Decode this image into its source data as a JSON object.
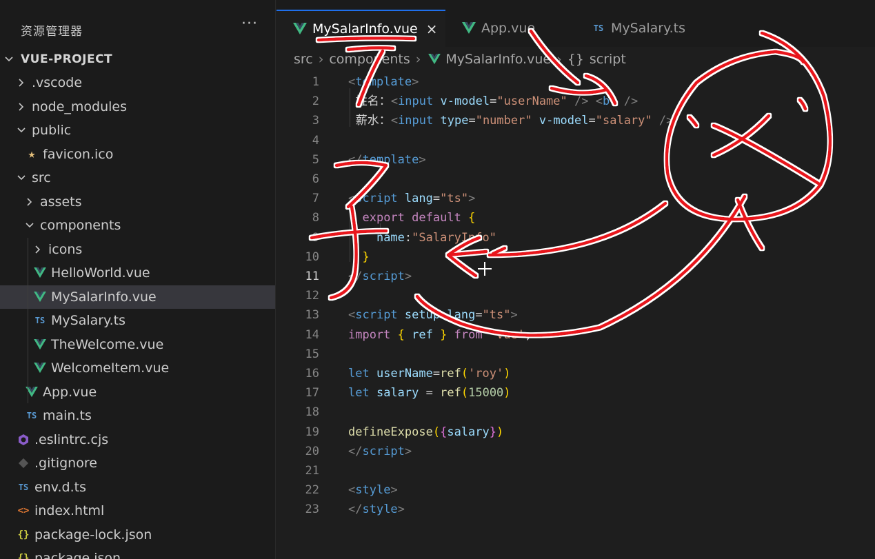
{
  "sidebar": {
    "title": "资源管理器",
    "more_label": "···",
    "root": "VUE-PROJECT",
    "items": [
      {
        "label": ".vscode",
        "kind": "folder",
        "state": "closed"
      },
      {
        "label": "node_modules",
        "kind": "folder",
        "state": "closed"
      },
      {
        "label": "public",
        "kind": "folder",
        "state": "open"
      },
      {
        "label": "favicon.ico",
        "kind": "favicon"
      },
      {
        "label": "src",
        "kind": "folder",
        "state": "open"
      },
      {
        "label": "assets",
        "kind": "folder",
        "state": "closed"
      },
      {
        "label": "components",
        "kind": "folder",
        "state": "open"
      },
      {
        "label": "icons",
        "kind": "folder",
        "state": "closed"
      },
      {
        "label": "HelloWorld.vue",
        "kind": "vue"
      },
      {
        "label": "MySalarInfo.vue",
        "kind": "vue",
        "selected": true
      },
      {
        "label": "MySalary.ts",
        "kind": "ts"
      },
      {
        "label": "TheWelcome.vue",
        "kind": "vue"
      },
      {
        "label": "WelcomeItem.vue",
        "kind": "vue"
      },
      {
        "label": "App.vue",
        "kind": "vue"
      },
      {
        "label": "main.ts",
        "kind": "ts"
      },
      {
        "label": ".eslintrc.cjs",
        "kind": "eslint"
      },
      {
        "label": ".gitignore",
        "kind": "git"
      },
      {
        "label": "env.d.ts",
        "kind": "ts"
      },
      {
        "label": "index.html",
        "kind": "html"
      },
      {
        "label": "package-lock.json",
        "kind": "json"
      },
      {
        "label": "package.json",
        "kind": "json"
      }
    ]
  },
  "tabs": [
    {
      "label": "MySalarInfo.vue",
      "kind": "vue",
      "active": true,
      "close": "×"
    },
    {
      "label": "App.vue",
      "kind": "vue"
    },
    {
      "label": "MySalary.ts",
      "kind": "ts"
    }
  ],
  "icons": {
    "ts_badge": "TS",
    "json_badge": "{}",
    "html_badge": "<>"
  },
  "breadcrumb": {
    "src": "src",
    "components": "components",
    "file": "MySalarInfo.vue",
    "symbol_icon": "{}",
    "symbol": "script"
  },
  "editor": {
    "current_line": 11,
    "line_numbers": [
      "1",
      "2",
      "3",
      "4",
      "5",
      "6",
      "7",
      "8",
      "9",
      "10",
      "11",
      "12",
      "13",
      "14",
      "15",
      "16",
      "17",
      "18",
      "19",
      "20",
      "21",
      "22",
      "23"
    ],
    "lines": [
      [
        [
          "tk-br",
          "<"
        ],
        [
          "tk-tag",
          "template"
        ],
        [
          "tk-br",
          ">"
        ]
      ],
      [
        [
          "tk-cn",
          "  姓名："
        ],
        [
          "tk-br",
          "<"
        ],
        [
          "tk-tag",
          "input"
        ],
        [
          "tk-txt",
          " "
        ],
        [
          "tk-attr",
          "v-model"
        ],
        [
          "tk-punc",
          "="
        ],
        [
          "tk-str",
          "\"userName\""
        ],
        [
          "tk-txt",
          " "
        ],
        [
          "tk-br",
          "/>"
        ],
        [
          "tk-txt",
          " "
        ],
        [
          "tk-br",
          "<"
        ],
        [
          "tk-tag",
          "br"
        ],
        [
          "tk-txt",
          " "
        ],
        [
          "tk-br",
          "/>"
        ]
      ],
      [
        [
          "tk-cn",
          "  薪水："
        ],
        [
          "tk-br",
          "<"
        ],
        [
          "tk-tag",
          "input"
        ],
        [
          "tk-txt",
          " "
        ],
        [
          "tk-attr",
          "type"
        ],
        [
          "tk-punc",
          "="
        ],
        [
          "tk-str",
          "\"number\""
        ],
        [
          "tk-txt",
          " "
        ],
        [
          "tk-attr",
          "v-model"
        ],
        [
          "tk-punc",
          "="
        ],
        [
          "tk-str",
          "\"salary\""
        ],
        [
          "tk-txt",
          " "
        ],
        [
          "tk-br",
          "/>"
        ]
      ],
      [],
      [
        [
          "tk-br",
          "</"
        ],
        [
          "tk-tag",
          "template"
        ],
        [
          "tk-br",
          ">"
        ]
      ],
      [],
      [
        [
          "tk-br",
          "<"
        ],
        [
          "tk-tag",
          "script"
        ],
        [
          "tk-txt",
          " "
        ],
        [
          "tk-attr",
          "lang"
        ],
        [
          "tk-punc",
          "="
        ],
        [
          "tk-str",
          "\"ts\""
        ],
        [
          "tk-br",
          ">"
        ]
      ],
      [
        [
          "tk-txt",
          "  "
        ],
        [
          "tk-kw",
          "export"
        ],
        [
          "tk-txt",
          " "
        ],
        [
          "tk-kw",
          "default"
        ],
        [
          "tk-txt",
          " "
        ],
        [
          "tk-brace",
          "{"
        ]
      ],
      [
        [
          "tk-txt",
          "    "
        ],
        [
          "tk-var",
          "name"
        ],
        [
          "tk-punc",
          ":"
        ],
        [
          "tk-str",
          "\"SalaryInfo\""
        ]
      ],
      [
        [
          "tk-txt",
          "  "
        ],
        [
          "tk-brace",
          "}"
        ]
      ],
      [
        [
          "tk-br",
          "</"
        ],
        [
          "tk-tag",
          "script"
        ],
        [
          "tk-br",
          ">"
        ]
      ],
      [],
      [
        [
          "tk-br",
          "<"
        ],
        [
          "tk-tag",
          "script"
        ],
        [
          "tk-txt",
          " "
        ],
        [
          "tk-attr",
          "setup"
        ],
        [
          "tk-txt",
          " "
        ],
        [
          "tk-attr",
          "lang"
        ],
        [
          "tk-punc",
          "="
        ],
        [
          "tk-str",
          "\"ts\""
        ],
        [
          "tk-br",
          ">"
        ]
      ],
      [
        [
          "tk-kw",
          "import"
        ],
        [
          "tk-txt",
          " "
        ],
        [
          "tk-brace",
          "{"
        ],
        [
          "tk-txt",
          " "
        ],
        [
          "tk-var",
          "ref"
        ],
        [
          "tk-txt",
          " "
        ],
        [
          "tk-brace",
          "}"
        ],
        [
          "tk-txt",
          " "
        ],
        [
          "tk-kw",
          "from"
        ],
        [
          "tk-txt",
          " "
        ],
        [
          "tk-str",
          "'vue'"
        ],
        [
          "tk-punc",
          ";"
        ]
      ],
      [],
      [
        [
          "tk-decl",
          "let"
        ],
        [
          "tk-txt",
          " "
        ],
        [
          "tk-var",
          "userName"
        ],
        [
          "tk-punc",
          "="
        ],
        [
          "tk-fn",
          "ref"
        ],
        [
          "tk-brace",
          "("
        ],
        [
          "tk-str",
          "'roy'"
        ],
        [
          "tk-brace",
          ")"
        ]
      ],
      [
        [
          "tk-decl",
          "let"
        ],
        [
          "tk-txt",
          " "
        ],
        [
          "tk-var",
          "salary"
        ],
        [
          "tk-txt",
          " "
        ],
        [
          "tk-punc",
          "="
        ],
        [
          "tk-txt",
          " "
        ],
        [
          "tk-fn",
          "ref"
        ],
        [
          "tk-brace",
          "("
        ],
        [
          "tk-num",
          "15000"
        ],
        [
          "tk-brace",
          ")"
        ]
      ],
      [],
      [
        [
          "tk-fn",
          "defineExpose"
        ],
        [
          "tk-brace",
          "("
        ],
        [
          "tk-brace2",
          "{"
        ],
        [
          "tk-var",
          "salary"
        ],
        [
          "tk-brace2",
          "}"
        ],
        [
          "tk-brace",
          ")"
        ]
      ],
      [
        [
          "tk-br",
          "</"
        ],
        [
          "tk-tag",
          "script"
        ],
        [
          "tk-br",
          ">"
        ]
      ],
      [],
      [
        [
          "tk-br",
          "<"
        ],
        [
          "tk-tag",
          "style"
        ],
        [
          "tk-br",
          ">"
        ]
      ],
      [
        [
          "tk-br",
          "</"
        ],
        [
          "tk-tag",
          "style"
        ],
        [
          "tk-br",
          ">"
        ]
      ]
    ]
  },
  "colors": {
    "vue_green": "#41b883",
    "ts_blue": "#5a9bd5",
    "annotation_red": "#e8141c",
    "accent": "#1f6feb"
  }
}
